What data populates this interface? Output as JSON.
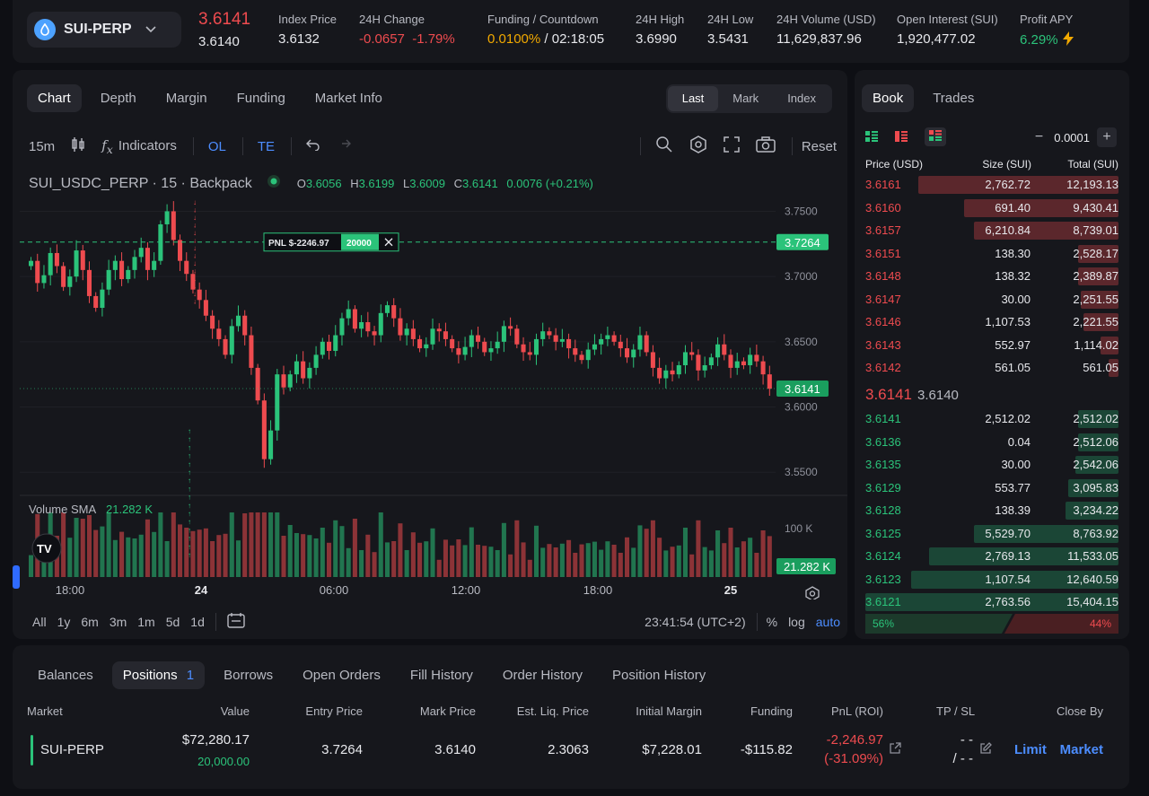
{
  "header": {
    "market": "SUI-PERP",
    "last_price": "3.6141",
    "last_price_sub": "3.6140",
    "stats": [
      {
        "label": "Index Price",
        "value": "3.6132"
      },
      {
        "label": "24H Change",
        "value": "-0.0657  -1.79%"
      },
      {
        "label": "Funding / Countdown",
        "value": "0.0100%",
        "value2": " / 02:18:05"
      },
      {
        "label": "24H High",
        "value": "3.6990"
      },
      {
        "label": "24H Low",
        "value": "3.5431"
      },
      {
        "label": "24H Volume (USD)",
        "value": "11,629,837.96"
      },
      {
        "label": "Open Interest (SUI)",
        "value": "1,920,477.02"
      },
      {
        "label": "Profit APY",
        "value": "6.29%"
      }
    ]
  },
  "chart_tabs": [
    "Chart",
    "Depth",
    "Margin",
    "Funding",
    "Market Info"
  ],
  "price_type": [
    "Last",
    "Mark",
    "Index"
  ],
  "toolbar": {
    "interval": "15m",
    "indicators": "Indicators",
    "ol": "OL",
    "te": "TE",
    "reset": "Reset"
  },
  "symbol_line": {
    "symbol": "SUI_USDC_PERP · 15 · Backpack",
    "o_label": "O",
    "o": "3.6056",
    "h_label": "H",
    "h": "3.6199",
    "l_label": "L",
    "l": "3.6009",
    "c_label": "C",
    "c": "3.6141",
    "change": "0.0076 (+0.21%)"
  },
  "chart_data": {
    "type": "candlestick",
    "yticks": [
      "3.7500",
      "3.7000",
      "3.6500",
      "3.6000",
      "3.5500"
    ],
    "ylim": [
      3.535,
      3.762
    ],
    "xticks": [
      "18:00",
      "24",
      "06:00",
      "12:00",
      "18:00",
      "25"
    ],
    "position_line": {
      "price": "3.7264",
      "pnl": "PNL $-2246.97",
      "qty": "20000"
    },
    "current_price": "3.6141",
    "volume_label": "Volume SMA",
    "volume_value": "21.282 K",
    "volume_tick": "100 K",
    "closes": [
      3.712,
      3.695,
      3.701,
      3.718,
      3.708,
      3.692,
      3.7,
      3.72,
      3.705,
      3.685,
      3.676,
      3.69,
      3.705,
      3.712,
      3.698,
      3.705,
      3.715,
      3.722,
      3.705,
      3.712,
      3.74,
      3.75,
      3.728,
      3.712,
      3.702,
      3.69,
      3.682,
      3.67,
      3.66,
      3.652,
      3.64,
      3.662,
      3.67,
      3.655,
      3.63,
      3.605,
      3.56,
      3.582,
      3.625,
      3.615,
      3.625,
      3.635,
      3.622,
      3.63,
      3.64,
      3.65,
      3.643,
      3.655,
      3.668,
      3.675,
      3.66,
      3.665,
      3.658,
      3.655,
      3.672,
      3.678,
      3.668,
      3.655,
      3.66,
      3.652,
      3.645,
      3.648,
      3.66,
      3.658,
      3.652,
      3.645,
      3.64,
      3.646,
      3.655,
      3.65,
      3.642,
      3.645,
      3.65,
      3.662,
      3.66,
      3.648,
      3.642,
      3.64,
      3.652,
      3.658,
      3.655,
      3.65,
      3.652,
      3.645,
      3.64,
      3.636,
      3.644,
      3.648,
      3.652,
      3.655,
      3.65,
      3.645,
      3.638,
      3.644,
      3.655,
      3.642,
      3.63,
      3.622,
      3.628,
      3.625,
      3.632,
      3.642,
      3.64,
      3.628,
      3.632,
      3.638,
      3.648,
      3.64,
      3.63,
      3.635,
      3.632,
      3.64,
      3.635,
      3.625,
      3.614
    ]
  },
  "bottom_bar": {
    "ranges": [
      "All",
      "1y",
      "6m",
      "3m",
      "1m",
      "5d",
      "1d"
    ],
    "time": "23:41:54 (UTC+2)",
    "pct": "%",
    "log": "log",
    "auto": "auto"
  },
  "book": {
    "tabs": [
      "Book",
      "Trades"
    ],
    "tick": "0.0001",
    "headers": {
      "price": "Price (USD)",
      "size": "Size (SUI)",
      "total": "Total (SUI)"
    },
    "asks": [
      {
        "price": "3.6161",
        "size": "2,762.72",
        "total": "12,193.13",
        "depth": 0.79
      },
      {
        "price": "3.6160",
        "size": "691.40",
        "total": "9,430.41",
        "depth": 0.61
      },
      {
        "price": "3.6157",
        "size": "6,210.84",
        "total": "8,739.01",
        "depth": 0.57
      },
      {
        "price": "3.6151",
        "size": "138.30",
        "total": "2,528.17",
        "depth": 0.16
      },
      {
        "price": "3.6148",
        "size": "138.32",
        "total": "2,389.87",
        "depth": 0.16
      },
      {
        "price": "3.6147",
        "size": "30.00",
        "total": "2,251.55",
        "depth": 0.15
      },
      {
        "price": "3.6146",
        "size": "1,107.53",
        "total": "2,221.55",
        "depth": 0.14
      },
      {
        "price": "3.6143",
        "size": "552.97",
        "total": "1,114.02",
        "depth": 0.07
      },
      {
        "price": "3.6142",
        "size": "561.05",
        "total": "561.05",
        "depth": 0.04
      }
    ],
    "mid": {
      "price": "3.6141",
      "mark": "3.6140"
    },
    "bids": [
      {
        "price": "3.6141",
        "size": "2,512.02",
        "total": "2,512.02",
        "depth": 0.16
      },
      {
        "price": "3.6136",
        "size": "0.04",
        "total": "2,512.06",
        "depth": 0.16
      },
      {
        "price": "3.6135",
        "size": "30.00",
        "total": "2,542.06",
        "depth": 0.17
      },
      {
        "price": "3.6129",
        "size": "553.77",
        "total": "3,095.83",
        "depth": 0.2
      },
      {
        "price": "3.6128",
        "size": "138.39",
        "total": "3,234.22",
        "depth": 0.21
      },
      {
        "price": "3.6125",
        "size": "5,529.70",
        "total": "8,763.92",
        "depth": 0.57
      },
      {
        "price": "3.6124",
        "size": "2,769.13",
        "total": "11,533.05",
        "depth": 0.75
      },
      {
        "price": "3.6123",
        "size": "1,107.54",
        "total": "12,640.59",
        "depth": 0.82
      },
      {
        "price": "3.6121",
        "size": "2,763.56",
        "total": "15,404.15",
        "depth": 1.0
      }
    ],
    "bid_pct": "56%",
    "ask_pct": "44%",
    "bid_fraction": 0.56
  },
  "positions": {
    "tabs": [
      "Balances",
      "Positions",
      "Borrows",
      "Open Orders",
      "Fill History",
      "Order History",
      "Position History"
    ],
    "positions_count": "1",
    "headers": [
      "Market",
      "Value",
      "Entry Price",
      "Mark Price",
      "Est. Liq. Price",
      "Initial Margin",
      "Funding",
      "PnL (ROI)",
      "TP / SL",
      "Close By"
    ],
    "row": {
      "market": "SUI-PERP",
      "value": "$72,280.17",
      "qty": "20,000.00",
      "entry": "3.7264",
      "mark": "3.6140",
      "liq": "2.3063",
      "margin": "$7,228.01",
      "funding": "-$115.82",
      "pnl": "-2,246.97",
      "roi": "(-31.09%)",
      "tp": "- -",
      "sl": "/ - -",
      "limit": "Limit",
      "market_btn": "Market"
    }
  },
  "colors": {
    "green": "#2bc37a",
    "red": "#ee4b4f",
    "accent": "#4c8dff",
    "funding": "#f2a900"
  }
}
